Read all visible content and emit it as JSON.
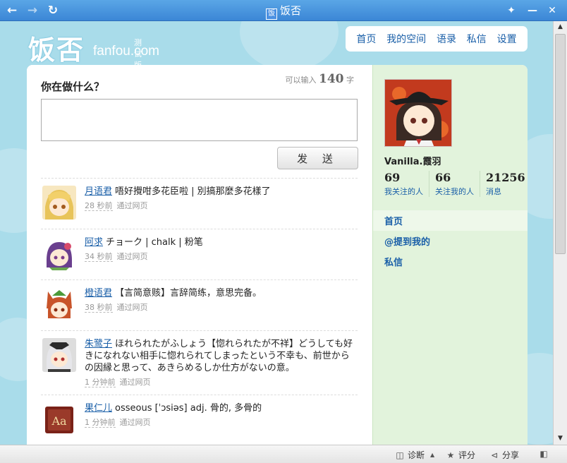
{
  "window": {
    "title": "饭否",
    "favicon": "饭"
  },
  "logo": {
    "cn": "饭否",
    "en": "fanfou.com",
    "beta": "测试版"
  },
  "topnav": [
    "首页",
    "我的空间",
    "语录",
    "私信",
    "设置"
  ],
  "composer": {
    "question": "你在做什么？",
    "counter_prefix": "可以输入",
    "counter_num": "140",
    "counter_suffix": "字",
    "placeholder": "",
    "send_label": "发 送"
  },
  "stream": [
    {
      "user": "月语君",
      "text": "唔好攪咁多花臣啦 | 別搞那麼多花樣了",
      "time": "28 秒前",
      "source": "通过网页"
    },
    {
      "user": "阿求",
      "text": "チョーク | chalk | 粉笔",
      "time": "34 秒前",
      "source": "通过网页"
    },
    {
      "user": "橙语君",
      "text": "【言简意赅】言辞简练，意思完备。",
      "time": "38 秒前",
      "source": "通过网页"
    },
    {
      "user": "朱鹭子",
      "text": "ほれられたがふしょう【惚れられたが不祥】どうしても好きになれない相手に惚れられてしまったという不幸も、前世からの因縁と思って、あきらめるしか仕方がないの意。",
      "time": "1 分钟前",
      "source": "通过网页"
    },
    {
      "user": "果仁儿",
      "text": "osseous [ˈɔsiəs] adj. 骨的, 多骨的",
      "time": "1 分钟前",
      "source": "通过网页"
    }
  ],
  "profile": {
    "name": "Vanilla.霞羽",
    "stats": [
      {
        "num": "69",
        "label": "我关注的人"
      },
      {
        "num": "66",
        "label": "关注我的人"
      },
      {
        "num": "21256",
        "label": "消息"
      }
    ],
    "nav": [
      "首页",
      "@提到我的",
      "私信"
    ]
  },
  "statusbar": {
    "diagnose": "诊断",
    "rate": "评分",
    "share": "分享"
  },
  "colors": {
    "link": "#1a5fa8",
    "sidebar": "#e2f3dc",
    "background": "#a9dcea",
    "titlebar": "#3b86d6"
  }
}
